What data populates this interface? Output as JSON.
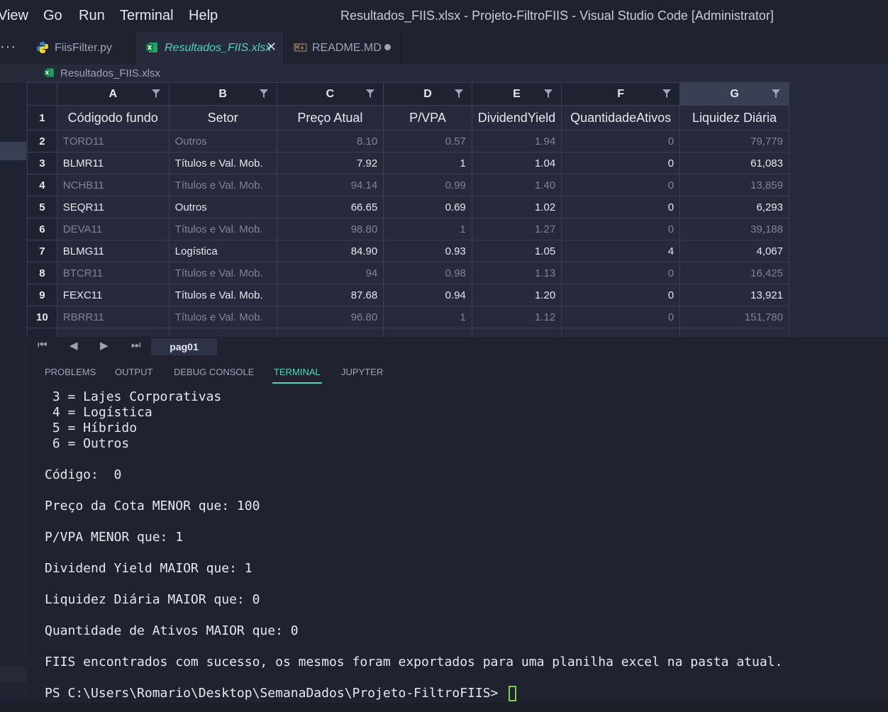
{
  "menu": [
    "View",
    "Go",
    "Run",
    "Terminal",
    "Help"
  ],
  "window_title": "Resultados_FIIS.xlsx - Projeto-FiltroFIIS - Visual Studio Code [Administrator]",
  "sidebar": {
    "more": "···"
  },
  "tabs": [
    {
      "label": "FiisFilter.py",
      "icon": "python-icon",
      "active": false
    },
    {
      "label": "Resultados_FIIS.xlsx",
      "icon": "excel-icon",
      "active": true,
      "close": "✕"
    },
    {
      "label": "README.MD",
      "icon": "markdown-icon",
      "active": false,
      "modified": true
    }
  ],
  "breadcrumb": {
    "file": "Resultados_FIIS.xlsx"
  },
  "sheet": {
    "columns": [
      "A",
      "B",
      "C",
      "D",
      "E",
      "F",
      "G"
    ],
    "header_row": [
      "Códigodo fundo",
      "Setor",
      "Preço Atual",
      "P/VPA",
      "DividendYield",
      "QuantidadeAtivos",
      "Liquidez Diária"
    ],
    "rows": [
      {
        "n": "2",
        "cells": [
          "TORD11",
          "Outros",
          "8.10",
          "0.57",
          "1.94",
          "0",
          "79,779"
        ]
      },
      {
        "n": "3",
        "cells": [
          "BLMR11",
          "Títulos e Val. Mob.",
          "7.92",
          "1",
          "1.04",
          "0",
          "61,083"
        ]
      },
      {
        "n": "4",
        "cells": [
          "NCHB11",
          "Títulos e Val. Mob.",
          "94.14",
          "0.99",
          "1.40",
          "0",
          "13,859"
        ]
      },
      {
        "n": "5",
        "cells": [
          "SEQR11",
          "Outros",
          "66.65",
          "0.69",
          "1.02",
          "0",
          "6,293"
        ]
      },
      {
        "n": "6",
        "cells": [
          "DEVA11",
          "Títulos e Val. Mob.",
          "98.80",
          "1",
          "1.27",
          "0",
          "39,188"
        ]
      },
      {
        "n": "7",
        "cells": [
          "BLMG11",
          "Logística",
          "84.90",
          "0.93",
          "1.05",
          "4",
          "4,067"
        ]
      },
      {
        "n": "8",
        "cells": [
          "BTCR11",
          "Títulos e Val. Mob.",
          "94",
          "0.98",
          "1.13",
          "0",
          "16,425"
        ]
      },
      {
        "n": "9",
        "cells": [
          "FEXC11",
          "Títulos e Val. Mob.",
          "87.68",
          "0.94",
          "1.20",
          "0",
          "13,921"
        ]
      },
      {
        "n": "10",
        "cells": [
          "RBRR11",
          "Títulos e Val. Mob.",
          "96.80",
          "1",
          "1.12",
          "0",
          "151,780"
        ]
      }
    ],
    "sheet_tab": "pag01",
    "selected_column": "G"
  },
  "panel_tabs": [
    "PROBLEMS",
    "OUTPUT",
    "DEBUG CONSOLE",
    "TERMINAL",
    "JUPYTER"
  ],
  "active_panel_tab": "TERMINAL",
  "terminal_lines": [
    " 3 = Lajes Corporativas",
    " 4 = Logística",
    " 5 = Híbrido",
    " 6 = Outros",
    "",
    "Código:  0",
    "",
    "Preço da Cota MENOR que: 100",
    "",
    "P/VPA MENOR que: 1",
    "",
    "Dividend Yield MAIOR que: 1",
    "",
    "Liquidez Diária MAIOR que: 0",
    "",
    "Quantidade de Ativos MAIOR que: 0",
    "",
    "FIIS encontrados com sucesso, os mesmos foram exportados para uma planilha excel na pasta atual.",
    "",
    "PS C:\\Users\\Romario\\Desktop\\SemanaDados\\Projeto-FiltroFIIS> "
  ],
  "colors": {
    "accent": "#4fd6be",
    "cursor": "#7fcf4a",
    "bg": "#262a3a"
  }
}
